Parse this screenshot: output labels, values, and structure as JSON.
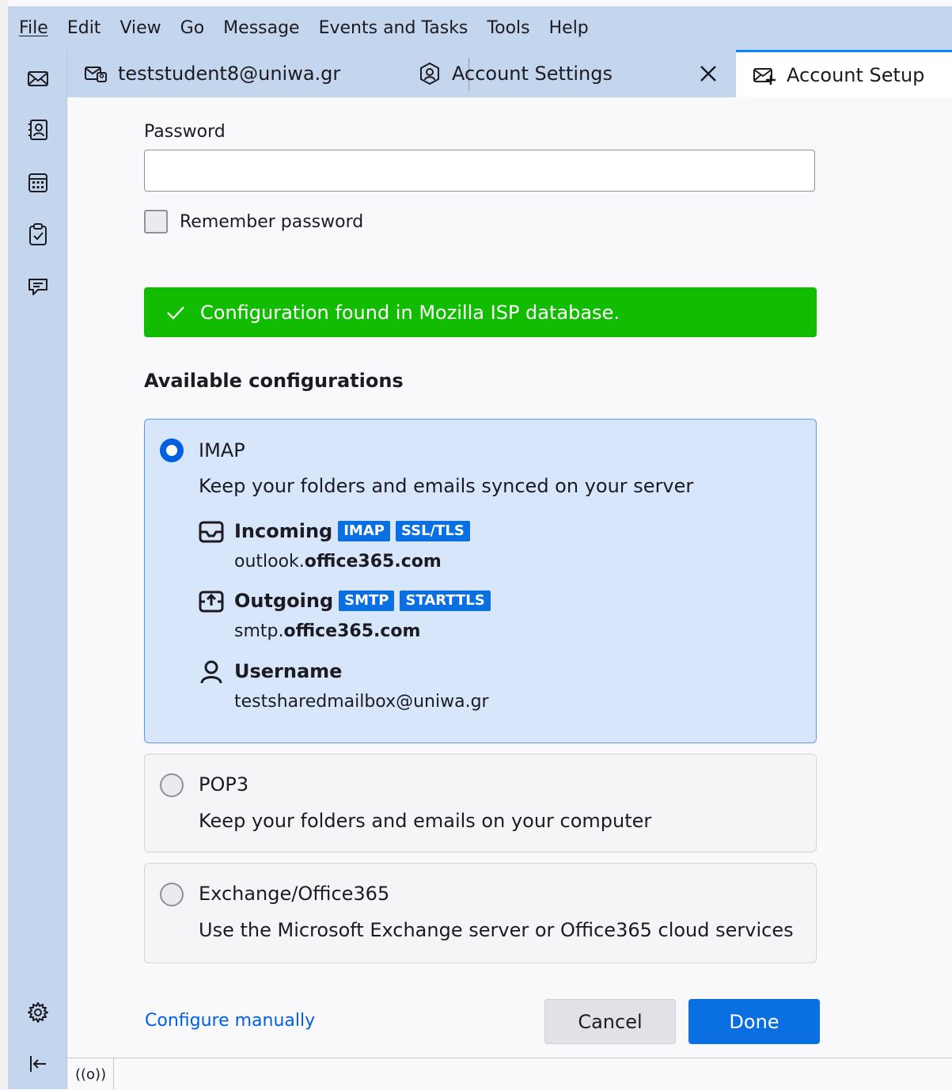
{
  "menubar": {
    "items": [
      "File",
      "Edit",
      "View",
      "Go",
      "Message",
      "Events and Tasks",
      "Tools",
      "Help"
    ]
  },
  "spaces": {
    "icons": [
      "mail-icon",
      "address-book-icon",
      "calendar-icon",
      "tasks-icon",
      "chat-icon",
      "settings-icon",
      "collapse-icon"
    ]
  },
  "tabs": [
    {
      "label": "teststudent8@uniwa.gr",
      "icon": "mail-folder-icon"
    },
    {
      "label": "Account Settings",
      "icon": "account-settings-icon"
    },
    {
      "label": "Account Setup",
      "icon": "account-setup-icon"
    }
  ],
  "form": {
    "password_label": "Password",
    "password_value": "",
    "remember_label": "Remember password",
    "remember_checked": false
  },
  "banner": {
    "text": "Configuration found in Mozilla ISP database.",
    "color": "#12bc00"
  },
  "configs": {
    "title": "Available configurations",
    "options": [
      {
        "name": "IMAP",
        "desc": "Keep your folders and emails synced on your server",
        "selected": true,
        "incoming": {
          "title": "Incoming",
          "badges": [
            "IMAP",
            "SSL/TLS"
          ],
          "host_prefix": "outlook.",
          "host_domain": "office365.com"
        },
        "outgoing": {
          "title": "Outgoing",
          "badges": [
            "SMTP",
            "STARTTLS"
          ],
          "host_prefix": "smtp.",
          "host_domain": "office365.com"
        },
        "username": {
          "title": "Username",
          "value": "testsharedmailbox@uniwa.gr"
        }
      },
      {
        "name": "POP3",
        "desc": "Keep your folders and emails on your computer",
        "selected": false
      },
      {
        "name": "Exchange/Office365",
        "desc": "Use the Microsoft Exchange server or Office365 cloud services",
        "selected": false
      }
    ]
  },
  "footer": {
    "configure_manually": "Configure manually",
    "cancel": "Cancel",
    "done": "Done"
  },
  "statusbar": {
    "icon": "((o))"
  },
  "colors": {
    "accent": "#0060df",
    "chrome": "#c4d5ee",
    "selected_card": "#d7e6fb"
  }
}
